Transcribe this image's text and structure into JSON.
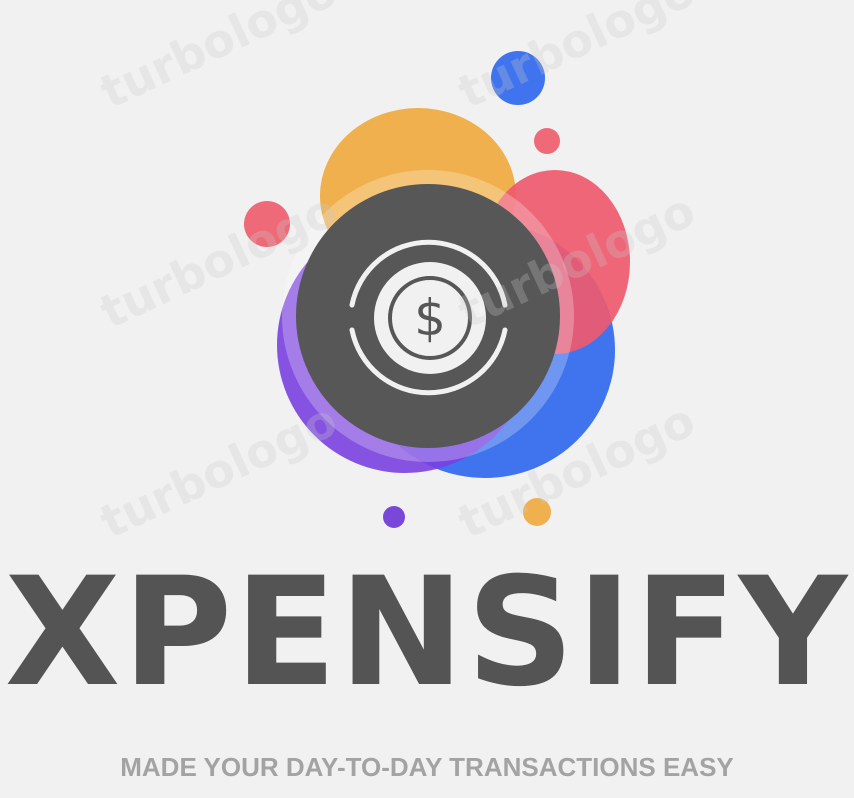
{
  "logo": {
    "brand_name": "XPENSIFY",
    "tagline": "MADE YOUR DAY-TO-DAY TRANSACTIONS EASY",
    "currency_symbol": "$",
    "watermark": "turbologo"
  },
  "colors": {
    "background": "#f1f1f1",
    "disk": "#575757",
    "brand_text": "#545454",
    "tagline_text": "#a3a3a3",
    "orange": "#f0b04d",
    "red": "#ee5a6e",
    "blue": "#3f74ee",
    "purple": "#7a40e0"
  }
}
